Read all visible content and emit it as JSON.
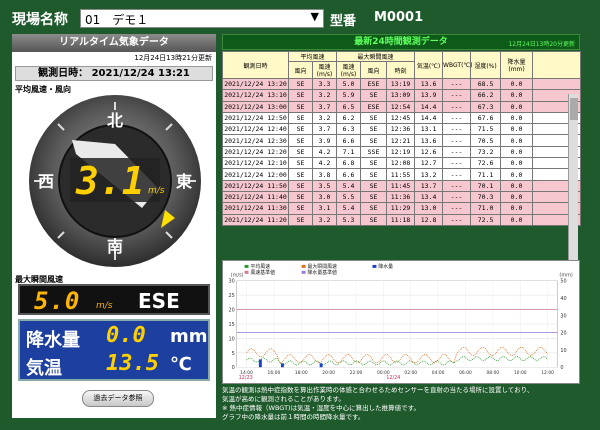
{
  "header": {
    "site_label": "現場名称",
    "site_value": "01　デモ１",
    "model_label": "型番",
    "model_value": "M0001"
  },
  "realtime": {
    "title": "リアルタイム気象データ",
    "updated": "12月24日13時21分更新",
    "obs_time": "観測日時： 2021/12/24 13:21",
    "wind_label": "平均風速・風向",
    "compass": {
      "n": "北",
      "e": "東",
      "s": "南",
      "w": "西",
      "speed": "3.1",
      "unit": "m/s"
    },
    "max_label": "最大瞬間風速",
    "max_speed": "5.0",
    "max_unit": "m/s",
    "max_dir": "ESE",
    "rain_label": "降水量",
    "rain_value": "0.0",
    "rain_unit": "mm",
    "temp_label": "気温",
    "temp_value": "13.5",
    "temp_unit": "℃",
    "history_button": "過去データ参照"
  },
  "table": {
    "title": "最新24時間観測データ",
    "updated": "12月24日13時20分更新",
    "h_time": "観測日時",
    "h_avg": "平均風速",
    "h_max": "最大瞬間風速",
    "h_dir": "風向",
    "h_speed": "風速(m/s)",
    "h_clock": "時刻",
    "h_temp": "気温(℃)",
    "h_wbgt": "WBGT(℃)",
    "h_hum": "湿度(%)",
    "h_rain": "降水量(mm)",
    "rows": [
      [
        "2021/12/24 13:20",
        "SE",
        "3.3",
        "5.0",
        "ESE",
        "13:19",
        "13.6",
        "---",
        "68.5",
        "0.0",
        "pink"
      ],
      [
        "2021/12/24 13:10",
        "SE",
        "3.2",
        "5.9",
        "SE",
        "13:09",
        "13.9",
        "---",
        "66.2",
        "0.0",
        "pink"
      ],
      [
        "2021/12/24 13:00",
        "SE",
        "3.7",
        "6.5",
        "ESE",
        "12:54",
        "14.4",
        "---",
        "67.3",
        "0.0",
        "pink"
      ],
      [
        "2021/12/24 12:50",
        "SE",
        "3.2",
        "6.2",
        "SE",
        "12:45",
        "14.4",
        "---",
        "67.6",
        "0.0",
        "white"
      ],
      [
        "2021/12/24 12:40",
        "SE",
        "3.7",
        "6.3",
        "SE",
        "12:36",
        "13.1",
        "---",
        "71.5",
        "0.0",
        "white"
      ],
      [
        "2021/12/24 12:30",
        "SE",
        "3.9",
        "6.6",
        "SE",
        "12:21",
        "13.6",
        "---",
        "70.5",
        "0.0",
        "white"
      ],
      [
        "2021/12/24 12:20",
        "SE",
        "4.2",
        "7.1",
        "SSE",
        "12:19",
        "12.6",
        "---",
        "73.2",
        "0.0",
        "white"
      ],
      [
        "2021/12/24 12:10",
        "SE",
        "4.2",
        "6.8",
        "SE",
        "12:08",
        "12.7",
        "---",
        "72.6",
        "0.0",
        "white"
      ],
      [
        "2021/12/24 12:00",
        "SE",
        "3.8",
        "6.6",
        "SE",
        "11:55",
        "13.2",
        "---",
        "71.1",
        "0.0",
        "white"
      ],
      [
        "2021/12/24 11:50",
        "SE",
        "3.5",
        "5.4",
        "SE",
        "11:45",
        "13.7",
        "---",
        "70.1",
        "0.0",
        "pink"
      ],
      [
        "2021/12/24 11:40",
        "SE",
        "3.0",
        "5.5",
        "SE",
        "11:36",
        "13.4",
        "---",
        "70.3",
        "0.0",
        "pink"
      ],
      [
        "2021/12/24 11:30",
        "SE",
        "3.1",
        "5.4",
        "SE",
        "11:29",
        "13.0",
        "---",
        "71.0",
        "0.0",
        "pink"
      ],
      [
        "2021/12/24 11:20",
        "SE",
        "3.2",
        "5.3",
        "SE",
        "11:18",
        "12.8",
        "---",
        "72.5",
        "0.0",
        "pink"
      ]
    ]
  },
  "chart": {
    "legend": [
      "平均風速",
      "最大瞬間風速",
      "降水量",
      "風速基準値",
      "降水量基準値"
    ],
    "colors": {
      "avg": "#2a9a2a",
      "max": "#e07020",
      "rain": "#1f3fcf",
      "wind_ref": "#d27b8e",
      "rain_ref": "#9a7ad8"
    },
    "left_unit": "(m/s)",
    "right_unit": "(mm)",
    "y_left_ticks": [
      "30",
      "25",
      "20",
      "15",
      "10",
      "5",
      "0"
    ],
    "y_right_ticks": [
      "50",
      "40",
      "30",
      "20",
      "10",
      "0"
    ],
    "x_ticks": [
      "14:00",
      "16:00",
      "18:00",
      "20:00",
      "22:00",
      "00:00",
      "02:00",
      "04:00",
      "06:00",
      "08:00",
      "10:00",
      "12:00"
    ],
    "date_left": "12/23",
    "date_mid": "12/24"
  },
  "notes": [
    "気温の観測は熱中症指数を算出作業時の体感と合わせるためセンサーを直射の当たる場所に設置しており、",
    "気温が高めに観測されることがあります。",
    "※ 熱中症情報（WBGT)は気温・湿度を中心に算出した推算値です。",
    "グラフ中の降水量は前１時間の時間降水量です。"
  ]
}
